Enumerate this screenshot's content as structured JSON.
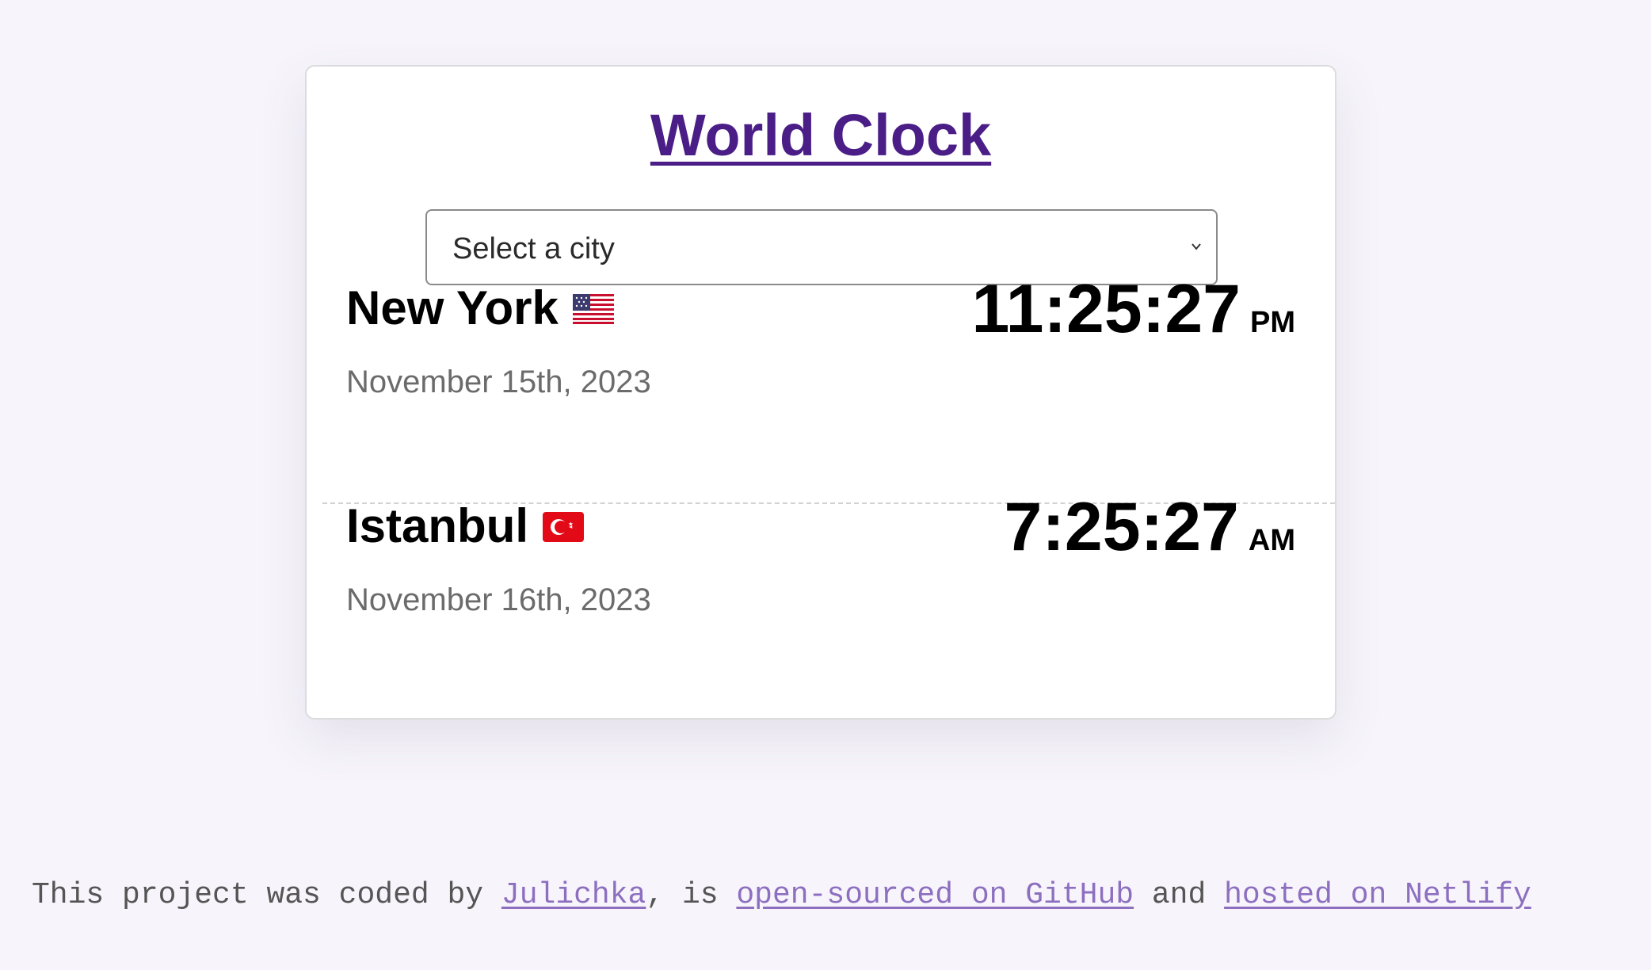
{
  "app": {
    "title": "World Clock"
  },
  "city_select": {
    "selected": "Select a city"
  },
  "cities": [
    {
      "name": "New York",
      "flag_icon": "us-flag-icon",
      "date": "November 15th, 2023",
      "time": "11:25:27",
      "period": "PM"
    },
    {
      "name": "Istanbul",
      "flag_icon": "turkey-flag-icon",
      "date": "November 16th, 2023",
      "time": "7:25:27",
      "period": "AM"
    }
  ],
  "footer": {
    "text_1": "This project was coded by ",
    "author_link": "Julichka",
    "text_2": ", is ",
    "github_link": "open-sourced on GitHub",
    "text_3": " and ",
    "netlify_link": "hosted on Netlify"
  },
  "colors": {
    "background": "#f7f5fb",
    "title": "#4a1d87",
    "link": "#8d6fc0",
    "date_text": "#6b6b6b"
  }
}
